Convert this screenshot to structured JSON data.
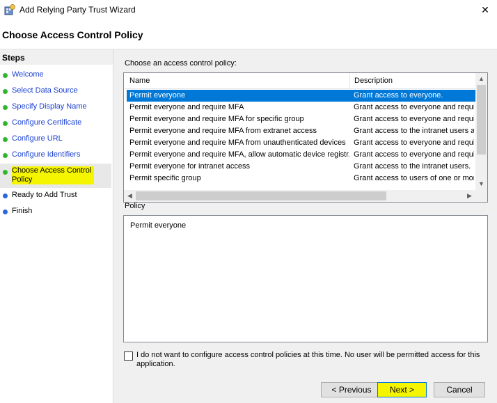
{
  "window": {
    "title": "Add Relying Party Trust Wizard",
    "close_glyph": "✕"
  },
  "page": {
    "heading": "Choose Access Control Policy"
  },
  "steps": {
    "header": "Steps",
    "items": [
      {
        "label": "Welcome",
        "status": "done"
      },
      {
        "label": "Select Data Source",
        "status": "done"
      },
      {
        "label": "Specify Display Name",
        "status": "done"
      },
      {
        "label": "Configure Certificate",
        "status": "done"
      },
      {
        "label": "Configure URL",
        "status": "done"
      },
      {
        "label": "Configure Identifiers",
        "status": "done"
      },
      {
        "label": "Choose Access Control Policy",
        "status": "current"
      },
      {
        "label": "Ready to Add Trust",
        "status": "pending"
      },
      {
        "label": "Finish",
        "status": "pending"
      }
    ]
  },
  "policy_list": {
    "label": "Choose an access control policy:",
    "columns": [
      "Name",
      "Description"
    ],
    "selected_index": 0,
    "rows": [
      {
        "name": "Permit everyone",
        "description": "Grant access to everyone."
      },
      {
        "name": "Permit everyone and require MFA",
        "description": "Grant access to everyone and requir"
      },
      {
        "name": "Permit everyone and require MFA for specific group",
        "description": "Grant access to everyone and requir"
      },
      {
        "name": "Permit everyone and require MFA from extranet access",
        "description": "Grant access to the intranet users an"
      },
      {
        "name": "Permit everyone and require MFA from unauthenticated devices",
        "description": "Grant access to everyone and requir"
      },
      {
        "name": "Permit everyone and require MFA, allow automatic device registr...",
        "description": "Grant access to everyone and requir"
      },
      {
        "name": "Permit everyone for intranet access",
        "description": "Grant access to the intranet users."
      },
      {
        "name": "Permit specific group",
        "description": "Grant access to users of one or more"
      }
    ]
  },
  "policy": {
    "label": "Policy",
    "text": "Permit everyone"
  },
  "optout": {
    "label": "I do not want to configure access control policies at this time. No user will be permitted access for this application.",
    "checked": false
  },
  "buttons": {
    "previous": "< Previous",
    "next": "Next >",
    "cancel": "Cancel"
  },
  "colors": {
    "highlight": "#f5f500",
    "selection": "#0078d7",
    "done_dot": "#2fb62f",
    "pending_dot": "#2b66d9",
    "link_text": "#1a3fd1"
  }
}
